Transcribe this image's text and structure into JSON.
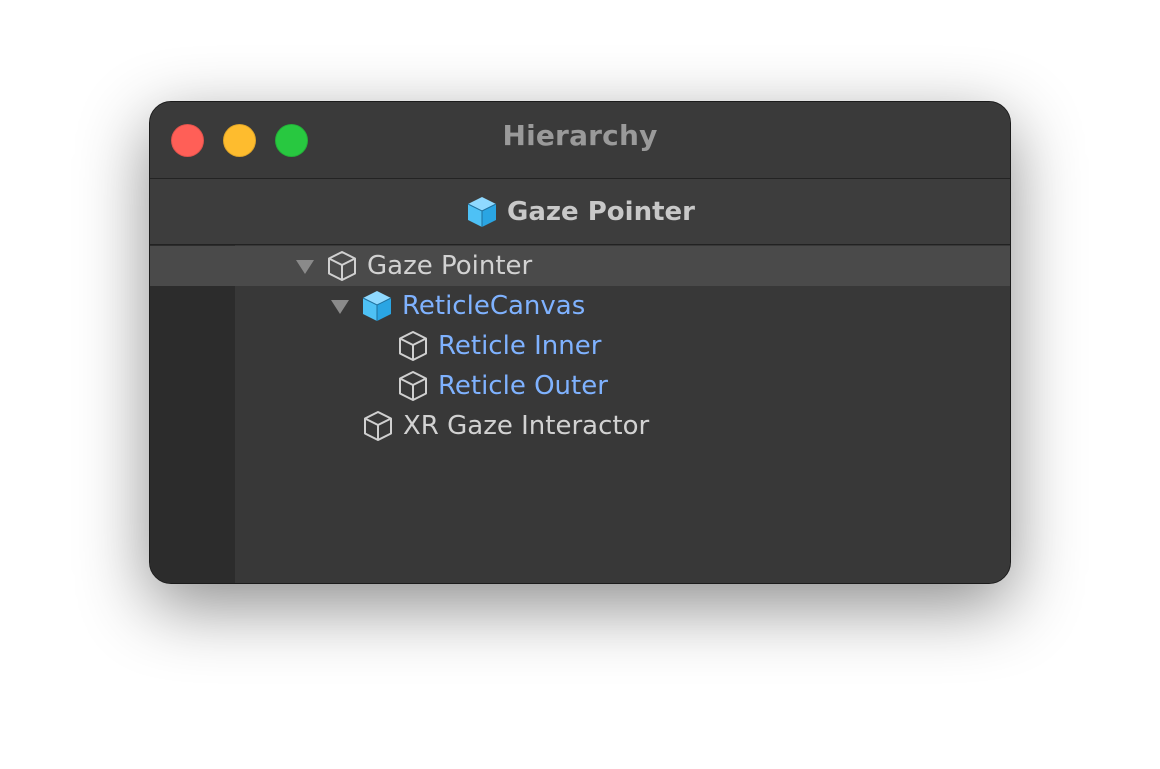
{
  "window": {
    "title": "Hierarchy"
  },
  "breadcrumb": {
    "icon": "prefab-cube-icon",
    "label": "Gaze Pointer"
  },
  "colors": {
    "prefab_blue": "#7fb2ff",
    "cube_blue": "#4ec1f5",
    "text_white": "#d2d2d2",
    "close": "#ff5f57",
    "minimize": "#febc2e",
    "maximize": "#28c840"
  },
  "tree": [
    {
      "label": "Gaze Pointer",
      "expanded": true,
      "prefab": false,
      "selected": true
    },
    {
      "label": "ReticleCanvas",
      "expanded": true,
      "prefab": true,
      "selected": false
    },
    {
      "label": "Reticle Inner",
      "prefab": true,
      "selected": false
    },
    {
      "label": "Reticle Outer",
      "prefab": true,
      "selected": false
    },
    {
      "label": "XR Gaze Interactor",
      "prefab": false,
      "selected": false
    }
  ]
}
